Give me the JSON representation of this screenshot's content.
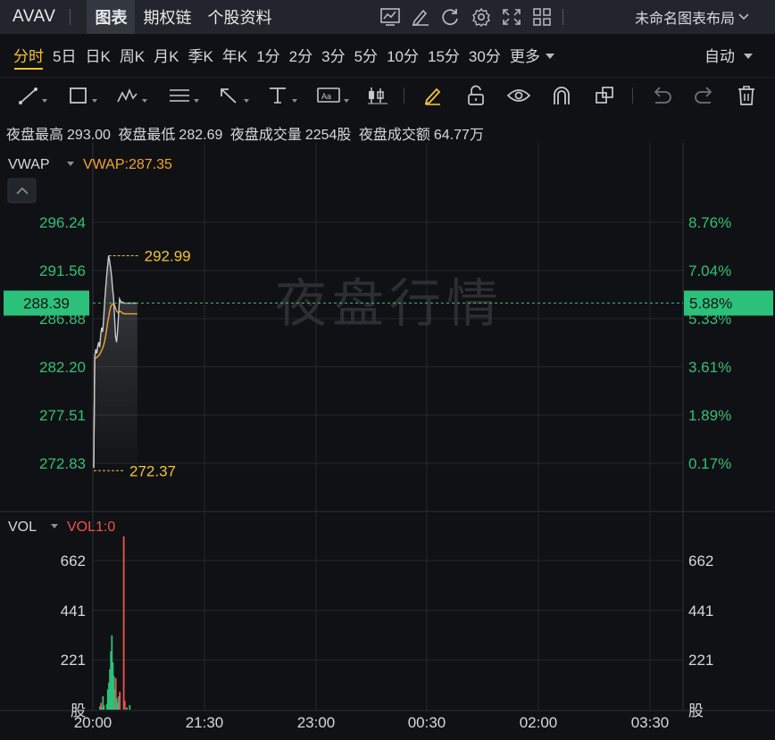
{
  "header": {
    "ticker": "AVAV",
    "tabs": [
      {
        "label": "图表",
        "active": true
      },
      {
        "label": "期权链",
        "active": false
      },
      {
        "label": "个股资料",
        "active": false
      }
    ],
    "icons": [
      "line-chart-icon",
      "edit-icon",
      "refresh-icon",
      "settings-icon",
      "fullscreen-icon",
      "grid-layout-icon"
    ],
    "layout_name": "未命名图表布局",
    "layout_dropdown_icon": "chevron-down-icon"
  },
  "periods": {
    "items": [
      "分时",
      "5日",
      "日K",
      "周K",
      "月K",
      "季K",
      "年K",
      "1分",
      "2分",
      "3分",
      "5分",
      "10分",
      "15分",
      "30分"
    ],
    "active": "分时",
    "more_label": "更多",
    "auto_label": "自动"
  },
  "toolbar": {
    "tools": [
      "trend-line-icon",
      "rectangle-icon",
      "wave-icon",
      "fibonacci-icon",
      "arrow-icon",
      "text-tool-icon",
      "label-icon",
      "candle-icon",
      "pencil-icon",
      "unlock-icon",
      "eye-icon",
      "magnet-icon",
      "layers-icon",
      "undo-icon",
      "redo-icon",
      "trash-icon"
    ]
  },
  "info": {
    "high_label": "夜盘最高",
    "high_value": "293.00",
    "low_label": "夜盘最低",
    "low_value": "282.69",
    "vol_label": "夜盘成交量",
    "vol_value": "2254股",
    "amt_label": "夜盘成交额",
    "amt_value": "64.77万"
  },
  "price_panel": {
    "indicator": "VWAP",
    "indicator_value": "VWAP:287.35",
    "watermark": "夜盘行情",
    "current_price": "288.39",
    "current_pct": "5.88%",
    "high_marker": "292.99",
    "low_marker": "272.37"
  },
  "volume_panel": {
    "indicator": "VOL",
    "indicator_value": "VOL1:0",
    "unit_label": "股"
  },
  "colors": {
    "background": "#101114",
    "accent": "#f3c234",
    "up_green": "#2cc17b",
    "down_red": "#f0524e",
    "vwap": "#f5a623",
    "price_line": "#c8ccd2"
  },
  "chart_data": {
    "type": "line",
    "series": [
      {
        "name": "price",
        "x": [
          0,
          1,
          2,
          3,
          4,
          5,
          6,
          7,
          8,
          9,
          10,
          11,
          12,
          13,
          14,
          15,
          16,
          17,
          18,
          19,
          20,
          21,
          22,
          23,
          24,
          25,
          26,
          27,
          28,
          29,
          30,
          31,
          32,
          33,
          34,
          35,
          36,
          37,
          38,
          39,
          40,
          41,
          42,
          43,
          44
        ],
        "values": [
          272.37,
          283.2,
          283.9,
          283.5,
          284.2,
          284.6,
          284.1,
          285.3,
          286.0,
          285.6,
          286.9,
          288.5,
          289.8,
          291.0,
          292.0,
          292.99,
          292.5,
          291.8,
          291.0,
          289.8,
          288.9,
          287.0,
          285.1,
          284.6,
          285.6,
          287.2,
          288.8,
          288.6,
          288.4,
          288.5,
          288.4,
          288.39,
          288.39,
          288.39,
          288.39,
          288.39,
          288.39,
          288.39,
          288.39,
          288.39,
          288.39,
          288.39,
          288.39,
          288.39,
          288.39
        ]
      },
      {
        "name": "VWAP",
        "x": [
          0,
          1,
          2,
          3,
          4,
          5,
          6,
          7,
          8,
          9,
          10,
          11,
          12,
          13,
          14,
          15,
          16,
          17,
          18,
          19,
          20,
          21,
          22,
          23,
          24,
          25,
          26,
          27,
          28,
          29,
          30,
          31,
          32,
          33,
          34,
          35,
          36,
          37,
          38,
          39,
          40,
          41,
          42,
          43,
          44
        ],
        "values": [
          272.4,
          282.9,
          283.1,
          283.1,
          283.2,
          283.3,
          283.4,
          283.6,
          283.8,
          284.0,
          284.3,
          284.7,
          285.2,
          285.8,
          286.5,
          287.0,
          287.6,
          288.0,
          288.2,
          288.3,
          288.3,
          288.2,
          287.9,
          287.6,
          287.5,
          287.5,
          287.6,
          287.6,
          287.5,
          287.4,
          287.4,
          287.35,
          287.35,
          287.35,
          287.35,
          287.35,
          287.35,
          287.35,
          287.35,
          287.35,
          287.35,
          287.35,
          287.35,
          287.35,
          287.35
        ]
      }
    ],
    "volume": {
      "values": [
        0,
        0,
        0,
        0,
        0,
        0,
        15,
        30,
        10,
        60,
        20,
        0,
        0,
        25,
        90,
        120,
        180,
        260,
        330,
        210,
        150,
        90,
        140,
        50,
        30,
        60,
        80,
        0,
        0,
        0,
        770,
        40,
        0,
        10,
        0,
        0,
        20,
        0,
        0,
        0,
        0,
        0,
        0,
        0,
        0
      ],
      "colors": [
        "g",
        "g",
        "g",
        "g",
        "g",
        "g",
        "g",
        "r",
        "g",
        "g",
        "g",
        "g",
        "g",
        "g",
        "g",
        "g",
        "g",
        "g",
        "g",
        "g",
        "g",
        "g",
        "r",
        "g",
        "g",
        "g",
        "r",
        "g",
        "g",
        "g",
        "r",
        "r",
        "g",
        "g",
        "g",
        "g",
        "g",
        "g",
        "g",
        "g",
        "g",
        "g",
        "g",
        "g",
        "g"
      ]
    },
    "price_ticks": [
      "296.24",
      "291.56",
      "286.88",
      "282.20",
      "277.51",
      "272.83"
    ],
    "pct_ticks": [
      "8.76%",
      "7.04%",
      "5.33%",
      "3.61%",
      "1.89%",
      "0.17%"
    ],
    "vol_ticks": [
      "662",
      "441",
      "221"
    ],
    "time_ticks": [
      "20:00",
      "21:30",
      "23:00",
      "00:30",
      "02:00",
      "03:30"
    ],
    "ylim": [
      272.83,
      296.24
    ],
    "vol_ylim": [
      0,
      662
    ],
    "grid": true
  }
}
